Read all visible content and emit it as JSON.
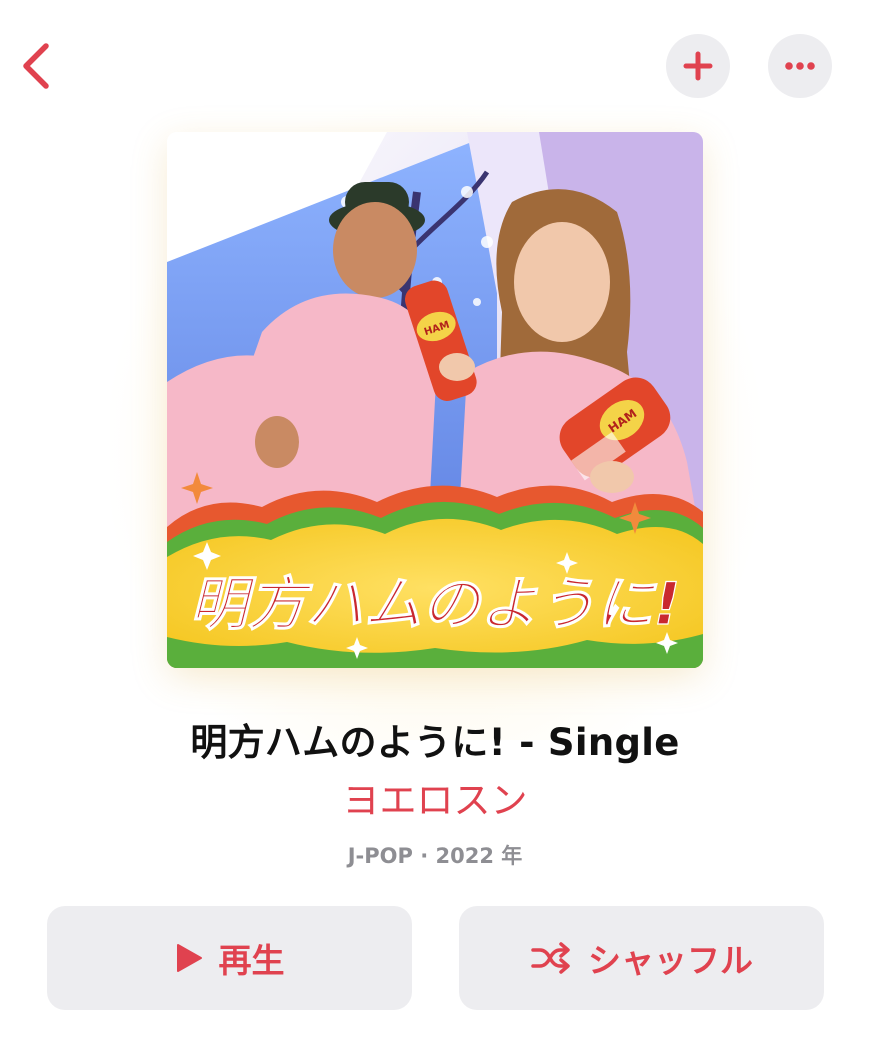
{
  "nav": {
    "back_icon": "chevron-left-icon",
    "add_icon": "plus-icon",
    "more_icon": "ellipsis-icon"
  },
  "artwork": {
    "overlay_text": "明方ハムのように!",
    "can_label": "HAM"
  },
  "album": {
    "title": "明方ハムのように! - Single",
    "artist": "ヨエロスン",
    "meta": "J-POP · 2022 年"
  },
  "actions": {
    "play_label": "再生",
    "play_icon": "play-icon",
    "shuffle_label": "シャッフル",
    "shuffle_icon": "shuffle-icon"
  },
  "colors": {
    "accent": "#e0424f",
    "button_bg": "#ededf0",
    "meta_text": "#8e8e93"
  }
}
